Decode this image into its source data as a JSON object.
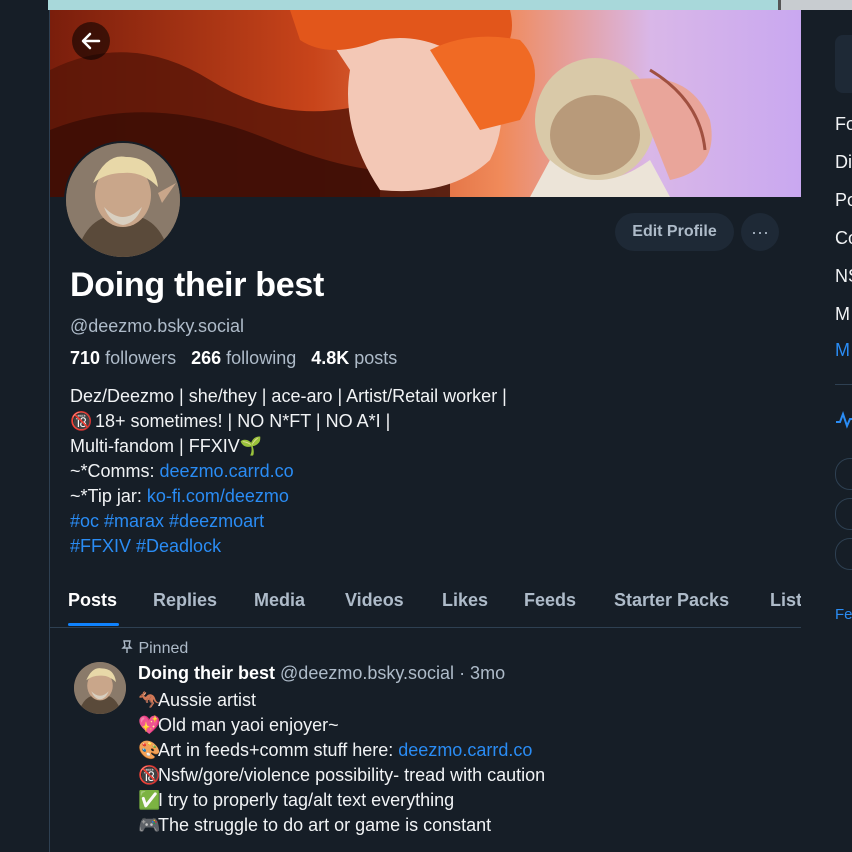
{
  "profile": {
    "display_name": "Doing their best",
    "handle": "@deezmo.bsky.social",
    "edit_label": "Edit Profile",
    "more_label": "···",
    "stats": {
      "followers_count": "710",
      "followers_label": "followers",
      "following_count": "266",
      "following_label": "following",
      "posts_count": "4.8K",
      "posts_label": "posts"
    },
    "bio": {
      "line1": "Dez/Deezmo | she/they | ace-aro | Artist/Retail worker |",
      "line2_emoji": "🔞",
      "line2": " 18+ sometimes! | NO N*FT | NO A*I |",
      "line3": "Multi-fandom | FFXIV🌱",
      "line4_prefix": "~*Comms: ",
      "line4_link": "deezmo.carrd.co",
      "line5_prefix": "~*Tip jar: ",
      "line5_link": "ko-fi.com/deezmo",
      "line6": "#oc #marax #deezmoart",
      "line7": "#FFXIV #Deadlock"
    }
  },
  "tabs": [
    "Posts",
    "Replies",
    "Media",
    "Videos",
    "Likes",
    "Feeds",
    "Starter Packs",
    "Lists"
  ],
  "pinned_post": {
    "pinned_label": "Pinned",
    "author_name": "Doing their best",
    "author_handle": "@deezmo.bsky.social",
    "time": "· 3mo",
    "lines": [
      {
        "emoji": "🦘",
        "text": "Aussie artist"
      },
      {
        "emoji": "💖",
        "text": "Old man yaoi enjoyer~"
      },
      {
        "emoji": "🎨",
        "text": "Art in feeds+comm stuff here: ",
        "link": "deezmo.carrd.co"
      },
      {
        "emoji": "🔞",
        "text": "Nsfw/gore/violence possibility- tread with caution"
      },
      {
        "emoji": "✅",
        "text": "I try to properly tag/alt text everything"
      },
      {
        "emoji": "🎮",
        "text": "The struggle to do art or game is constant"
      }
    ]
  },
  "right_sidebar": {
    "items": [
      "Fo",
      "Di",
      "Po",
      "Co",
      "NS",
      "M",
      "M"
    ],
    "footer": "Fe"
  },
  "colors": {
    "background": "#161e27",
    "accent": "#1083fe",
    "link": "#2a8cf4",
    "muted_text": "#aebbc9"
  }
}
